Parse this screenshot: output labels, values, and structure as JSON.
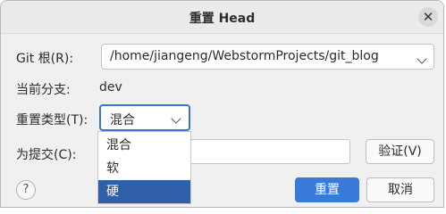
{
  "window": {
    "title": "重置 Head",
    "close_glyph": "✕"
  },
  "fields": {
    "git_root": {
      "label": "Git 根(R):",
      "value": "/home/jiangeng/WebstormProjects/git_blog"
    },
    "current_branch": {
      "label": "当前分支:",
      "value": "dev"
    },
    "reset_type": {
      "label": "重置类型(T):",
      "value": "混合",
      "options": [
        "混合",
        "软",
        "硬"
      ],
      "highlighted_option": "硬"
    },
    "to_commit": {
      "label": "为提交(C):",
      "value": ""
    }
  },
  "buttons": {
    "validate": "验证(V)",
    "reset": "重置",
    "cancel": "取消",
    "help": "?"
  },
  "colors": {
    "accent": "#3a7ad9",
    "highlight": "#2e5fa7"
  }
}
